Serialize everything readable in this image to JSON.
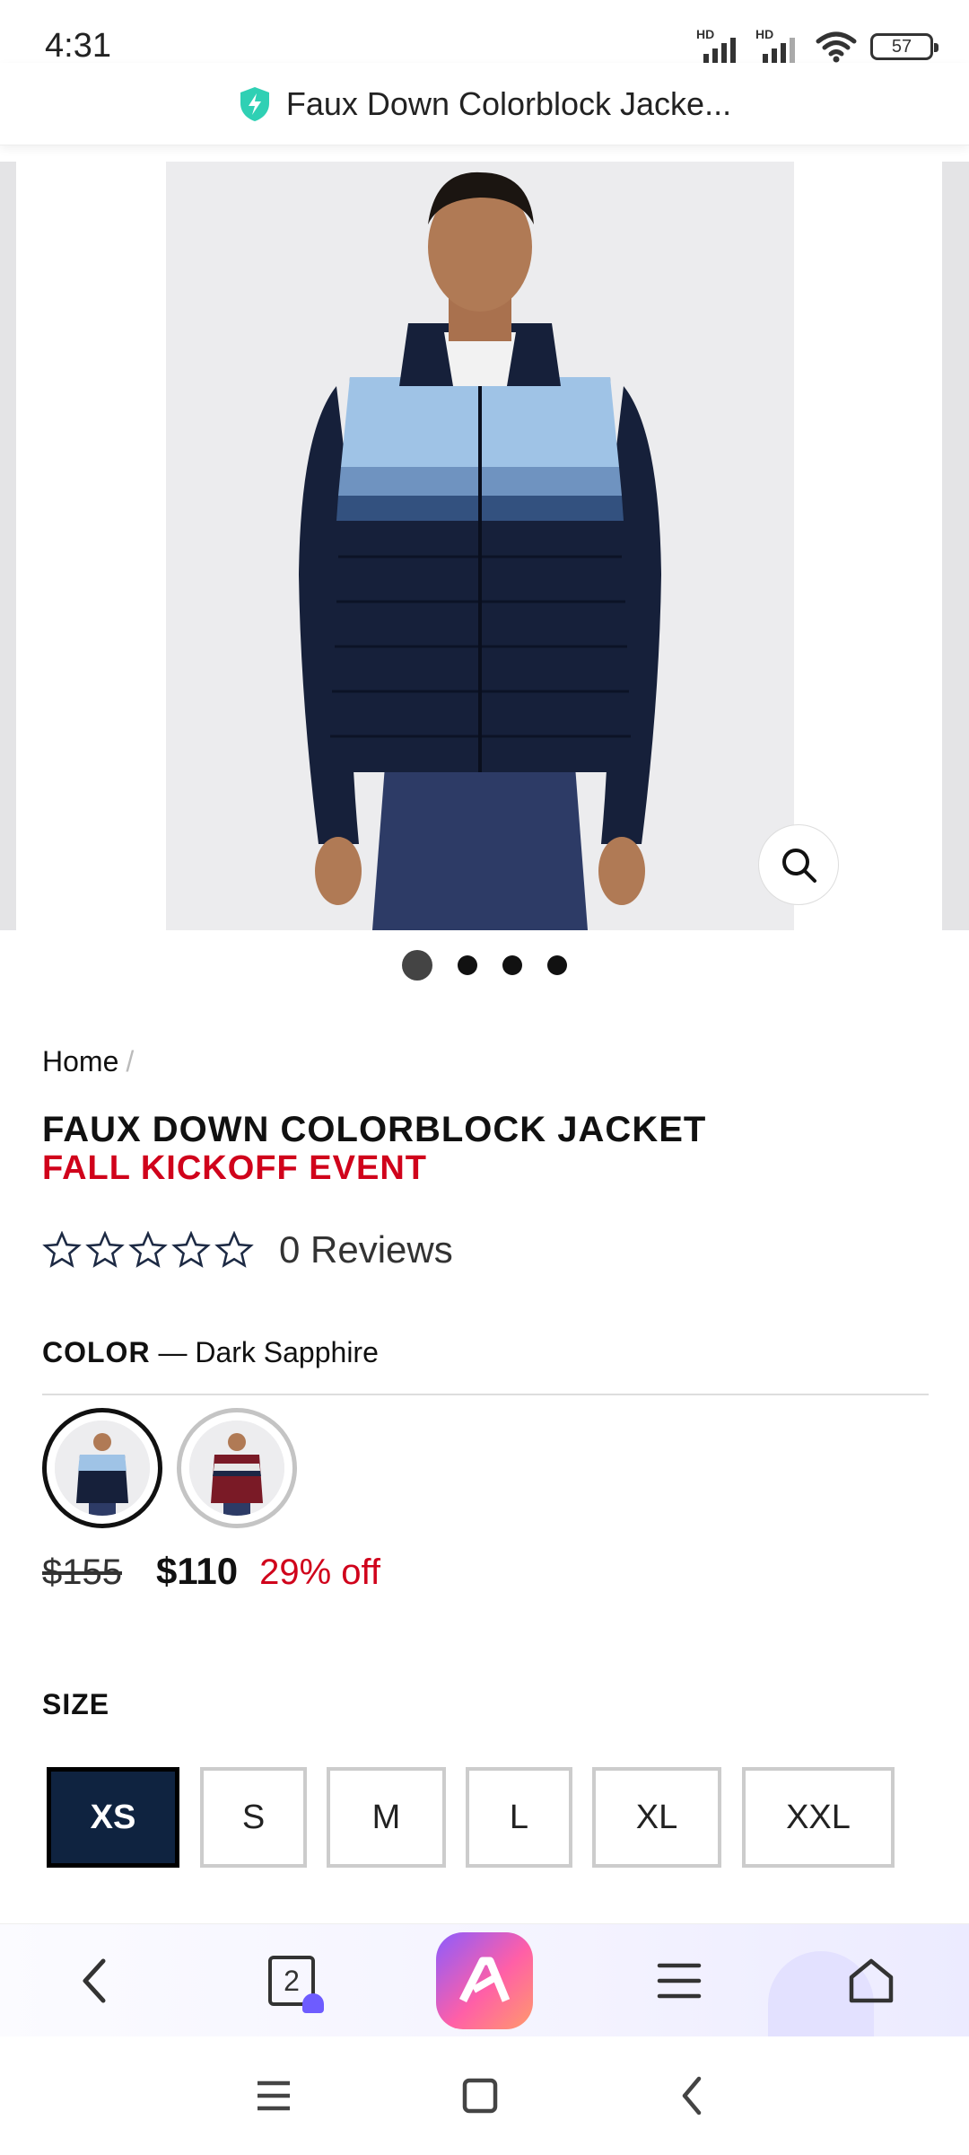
{
  "status_bar": {
    "time": "4:31",
    "hd_label": "HD",
    "battery": "57"
  },
  "browser": {
    "page_title": "Faux Down Colorblock Jacke..."
  },
  "gallery": {
    "image_count": 4,
    "active_index": 0
  },
  "breadcrumb": {
    "home": "Home",
    "separator": "/"
  },
  "product": {
    "title": "FAUX DOWN COLORBLOCK JACKET",
    "promo": "FALL KICKOFF EVENT",
    "rating_stars": 0,
    "reviews": "0 Reviews",
    "color_label": "COLOR",
    "color_dash": "—",
    "color_value": "Dark Sapphire",
    "price_was": "$155",
    "price_now": "$110",
    "discount": "29% off",
    "size_label": "SIZE",
    "sizes": [
      "XS",
      "S",
      "M",
      "L",
      "XL",
      "XXL"
    ],
    "selected_size": "XS"
  },
  "bottom_nav": {
    "tab_count": "2"
  },
  "colors": {
    "accent_red": "#d0021b",
    "selected_size_bg": "#0f2340",
    "jacket_navy": "#16203a",
    "jacket_light_blue": "#9fc3e6",
    "jacket_mid_blue": "#6f93c0",
    "alt_jacket_maroon": "#7a1a26"
  },
  "icons": {
    "signal": "signal-icon",
    "wifi": "wifi-icon",
    "battery": "battery-icon",
    "secure": "shield-bolt-icon",
    "zoom": "search-icon",
    "star": "star-outline-icon",
    "back": "chevron-left-icon",
    "tabs": "tabs-icon",
    "ai": "ai-assistant-icon",
    "menu": "menu-icon",
    "home": "home-icon",
    "sys_menu": "menu-icon",
    "sys_home": "square-icon",
    "sys_back": "chevron-left-icon"
  }
}
